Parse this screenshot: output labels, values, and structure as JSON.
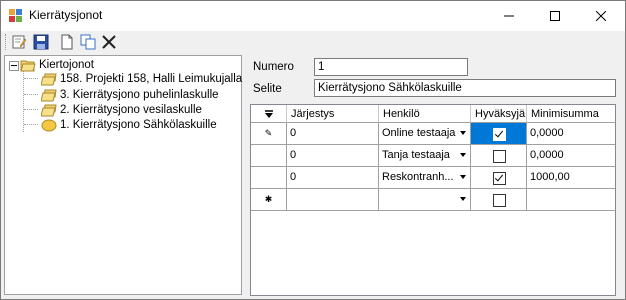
{
  "window": {
    "title": "Kierrätysjonot"
  },
  "toolbar": {
    "buttons": [
      {
        "name": "edit-icon"
      },
      {
        "name": "save-icon"
      },
      {
        "name": "new-document-icon"
      },
      {
        "name": "copy-icon"
      },
      {
        "name": "delete-icon"
      }
    ]
  },
  "tree": {
    "root": "Kiertojonot",
    "items": [
      {
        "label": "158. Projekti 158, Halli Leimukujalla"
      },
      {
        "label": "3. Kierrätysjono puhelinlaskulle"
      },
      {
        "label": "2. Kierrätysjono vesilaskulle"
      },
      {
        "label": "1. Kierrätysjono Sähkölaskuille",
        "selected": true
      }
    ]
  },
  "form": {
    "numero_label": "Numero",
    "numero_value": "1",
    "selite_label": "Selite",
    "selite_value": "Kierrätysjono Sähkölaskuille"
  },
  "grid": {
    "columns": [
      "Järjestys",
      "Henkilö",
      "Hyväksyjä",
      "Minimisumma"
    ],
    "rows": [
      {
        "jarjestys": "0",
        "henkilo": "Online testaaja",
        "hyvaksyja": true,
        "minimisumma": "0,0000",
        "marker": "✎"
      },
      {
        "jarjestys": "0",
        "henkilo": "Tanja testaaja",
        "hyvaksyja": false,
        "minimisumma": "0,0000",
        "marker": ""
      },
      {
        "jarjestys": "0",
        "henkilo": "Reskontranh...",
        "hyvaksyja": true,
        "minimisumma": "1000,00",
        "marker": ""
      },
      {
        "jarjestys": "",
        "henkilo": "",
        "hyvaksyja": false,
        "minimisumma": "",
        "marker": "✱"
      }
    ]
  },
  "colors": {
    "selection": "#0078d7",
    "titlebar": "#ffffff",
    "background": "#f0f0f0"
  }
}
